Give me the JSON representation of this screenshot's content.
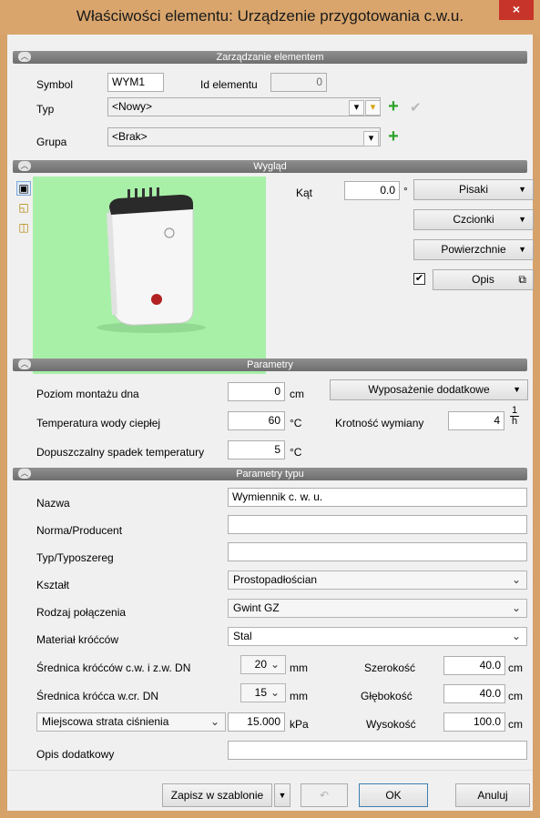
{
  "window": {
    "title": "Właściwości elementu: Urządzenie przygotowania c.w.u.",
    "close": "×"
  },
  "sections": {
    "element": "Zarządzanie elementem",
    "appearance": "Wygląd",
    "params": "Parametry",
    "type_params": "Parametry typu"
  },
  "element": {
    "symbol_label": "Symbol",
    "symbol_value": "WYM1",
    "id_label": "Id elementu",
    "id_value": "0",
    "type_label": "Typ",
    "type_value": "<Nowy>",
    "group_label": "Grupa",
    "group_value": "<Brak>"
  },
  "appearance": {
    "angle_label": "Kąt",
    "angle_value": "0.0",
    "angle_unit": "°",
    "pens": "Pisaki",
    "fonts": "Czcionki",
    "surfaces": "Powierzchnie",
    "description": "Opis",
    "description_checked": true
  },
  "params": {
    "bottom_level_label": "Poziom montażu dna",
    "bottom_level_value": "0",
    "bottom_level_unit": "cm",
    "accessories": "Wyposażenie dodatkowe",
    "hot_temp_label": "Temperatura wody ciepłej",
    "hot_temp_value": "60",
    "hot_temp_unit": "°C",
    "exchange_label": "Krotność wymiany",
    "exchange_value": "4",
    "exchange_unit_num": "1",
    "exchange_unit_den": "h",
    "temp_drop_label": "Dopuszczalny spadek temperatury",
    "temp_drop_value": "5",
    "temp_drop_unit": "°C"
  },
  "type_params": {
    "name_label": "Nazwa",
    "name_value": "Wymiennik c. w. u.",
    "norm_label": "Norma/Producent",
    "norm_value": "",
    "series_label": "Typ/Typoszereg",
    "series_value": "",
    "shape_label": "Kształt",
    "shape_value": "Prostopadłościan",
    "conn_label": "Rodzaj połączenia",
    "conn_value": "Gwint GZ",
    "material_label": "Materiał króćców",
    "material_value": "Stal",
    "dn_label": "Średnica króćców c.w. i z.w. DN",
    "dn_value": "20",
    "dn_unit": "mm",
    "dn_circ_label": "Średnica króćca w.cr. DN",
    "dn_circ_value": "15",
    "dn_circ_unit": "mm",
    "loss_select": "Miejscowa strata ciśnienia",
    "loss_value": "15.000",
    "loss_unit": "kPa",
    "width_label": "Szerokość",
    "width_value": "40.0",
    "width_unit": "cm",
    "depth_label": "Głębokość",
    "depth_value": "40.0",
    "depth_unit": "cm",
    "height_label": "Wysokość",
    "height_value": "100.0",
    "height_unit": "cm",
    "extra_label": "Opis dodatkowy",
    "extra_value": ""
  },
  "footer": {
    "save_template": "Zapisz w szablonie",
    "ok": "OK",
    "cancel": "Anuluj"
  }
}
